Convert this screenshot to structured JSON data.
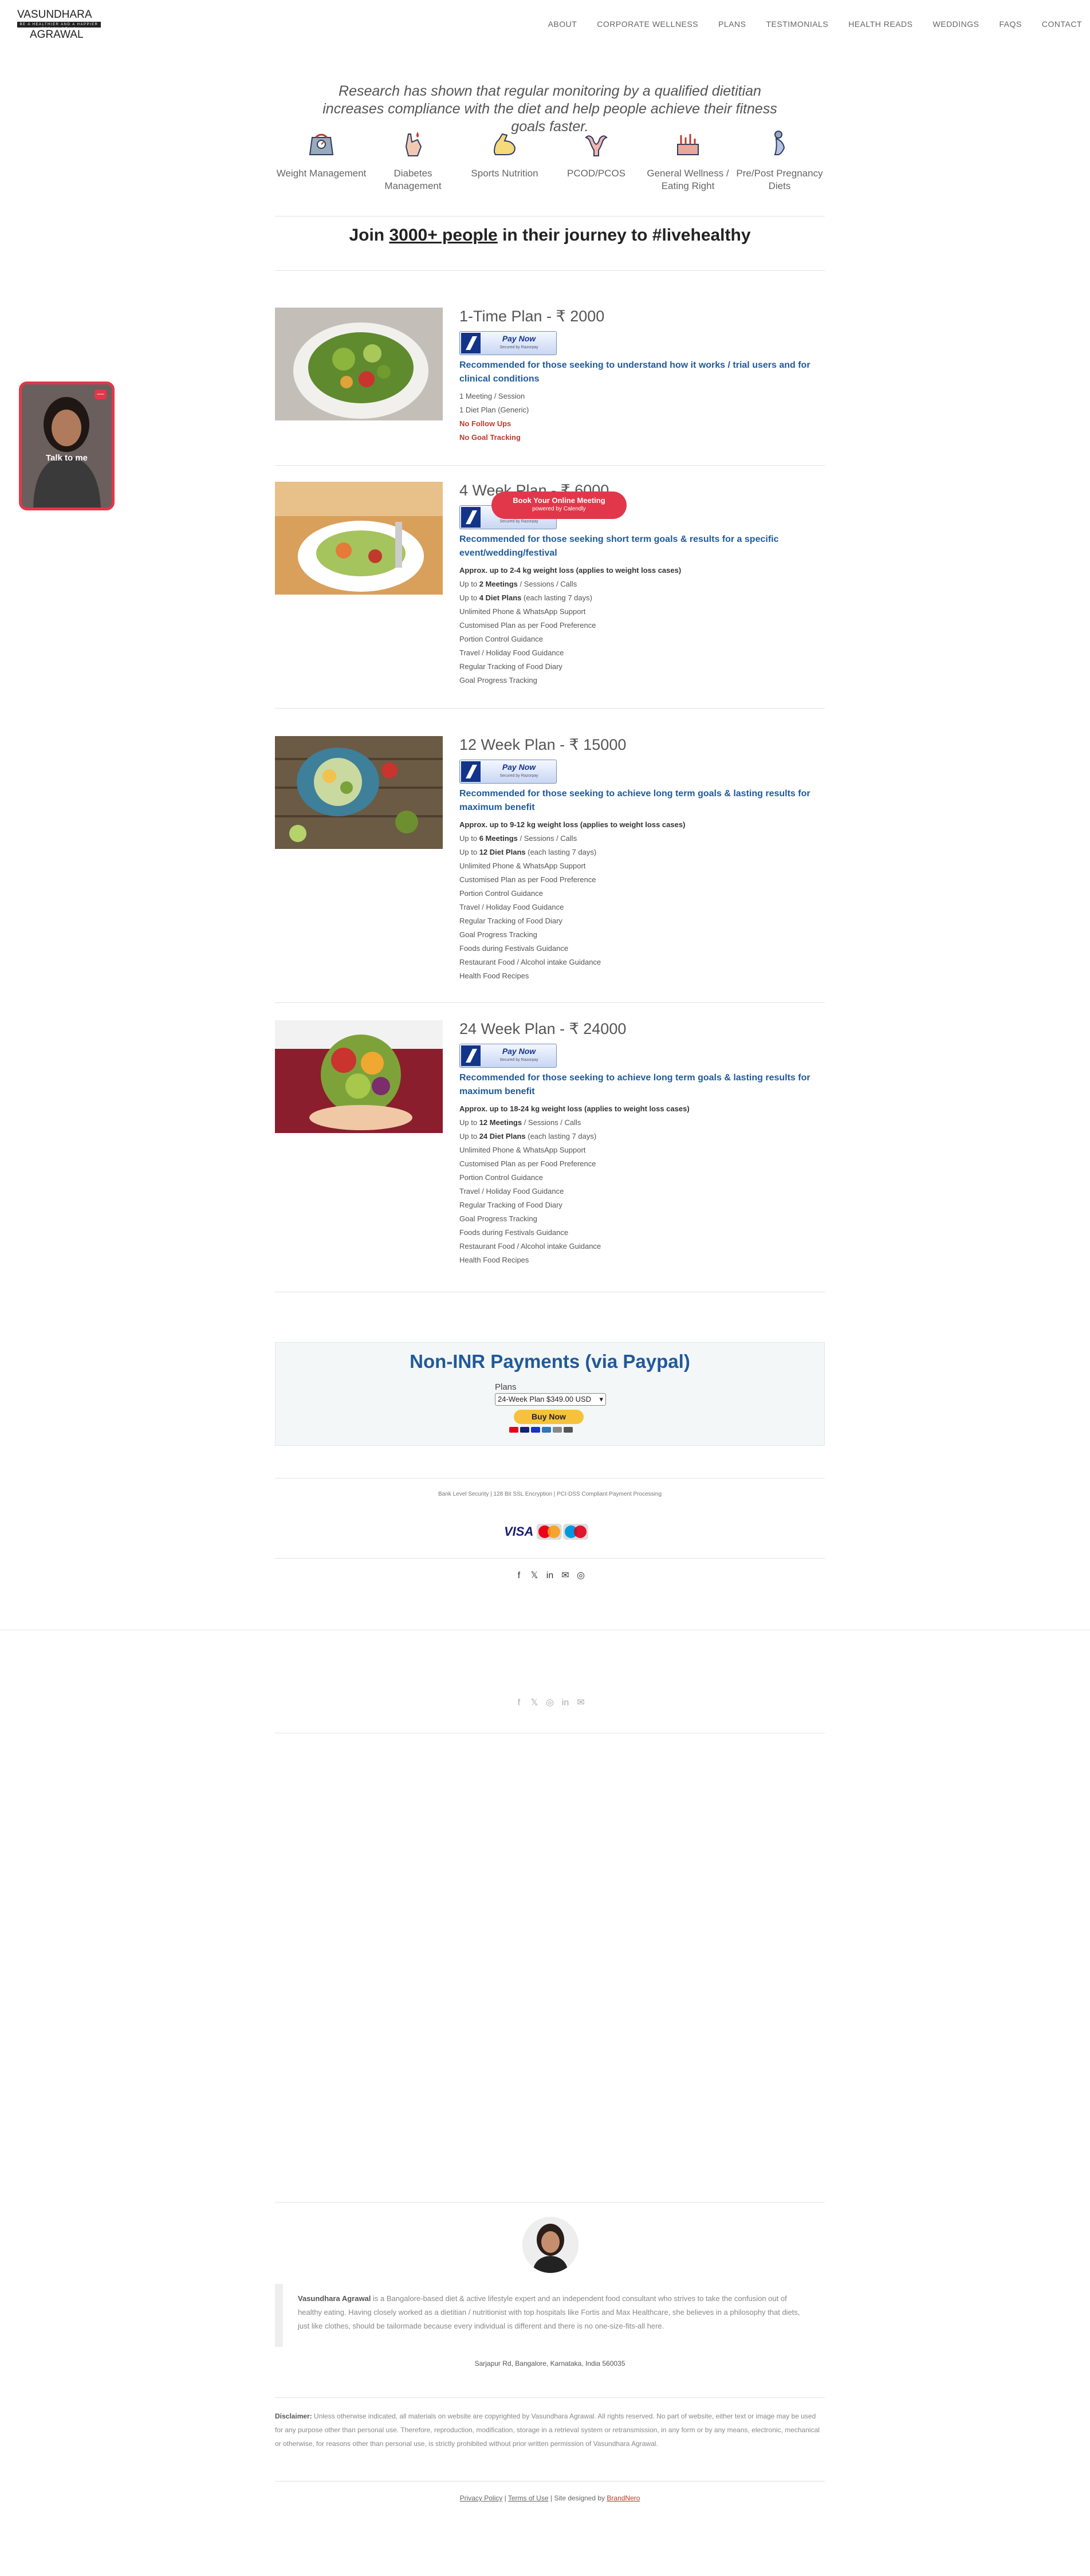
{
  "brand": {
    "line1": "VASUNDHARA",
    "line2": "BE A HEALTHIER AND A HAPPIER VERSION OF YOU",
    "line3": "AGRAWAL"
  },
  "nav": [
    "ABOUT",
    "CORPORATE WELLNESS",
    "PLANS",
    "TESTIMONIALS",
    "HEALTH READS",
    "WEDDINGS",
    "FAQS",
    "CONTACT"
  ],
  "intro": "Research has shown that regular monitoring by a qualified dietitian increases compliance with the diet and help people achieve their fitness goals faster.",
  "categories": [
    {
      "icon": "scale-icon",
      "label": "Weight Management"
    },
    {
      "icon": "diabetes-icon",
      "label": "Diabetes Management"
    },
    {
      "icon": "muscle-icon",
      "label": "Sports Nutrition"
    },
    {
      "icon": "uterus-icon",
      "label": "PCOD/PCOS"
    },
    {
      "icon": "wellness-icon",
      "label": "General Wellness / Eating Right"
    },
    {
      "icon": "pregnancy-icon",
      "label": "Pre/Post Pregnancy Diets"
    }
  ],
  "join": {
    "pre": "Join ",
    "link": "3000+ people",
    "post": " in their journey to #livehealthy"
  },
  "pay_button": {
    "label": "Pay Now",
    "secured": "Secured by Razorpay"
  },
  "plans": [
    {
      "title": "1-Time Plan - ₹ 2000",
      "rec": "Recommended for those seeking to understand how it works / trial users and for clinical conditions",
      "lines": [
        "1 Meeting / Session",
        "1 Diet Plan (Generic)"
      ],
      "red": [
        "No Follow Ups",
        "No Goal Tracking"
      ]
    },
    {
      "title": "4 Week Plan - ₹ 6000",
      "rec": "Recommended for those seeking short term goals & results for a specific event/wedding/festival",
      "bold": "Approx. up to 2-4 kg weight loss (applies to weight loss cases)",
      "l1": [
        "Up to ",
        "2 Meetings",
        " / Sessions / Calls"
      ],
      "l2": [
        "Up to ",
        "4 Diet Plans",
        " (each lasting 7 days)"
      ],
      "lines": [
        "Unlimited Phone & WhatsApp Support",
        "Customised Plan as per Food Preference",
        "Portion Control Guidance",
        "Travel / Holiday Food Guidance",
        "Regular Tracking of Food Diary",
        "Goal Progress Tracking"
      ]
    },
    {
      "title": "12 Week Plan - ₹ 15000",
      "rec": "Recommended for those seeking to achieve long term goals & lasting results for maximum benefit",
      "bold": "Approx. up to 9-12 kg weight loss (applies to weight loss cases)",
      "l1": [
        "Up to ",
        "6 Meetings",
        " / Sessions / Calls"
      ],
      "l2": [
        "Up to ",
        "12 Diet Plans",
        " (each lasting 7 days)"
      ],
      "lines": [
        "Unlimited Phone & WhatsApp Support",
        "Customised Plan as per Food Preference",
        "Portion Control Guidance",
        "Travel / Holiday Food Guidance",
        "Regular Tracking of Food Diary",
        "Goal Progress Tracking",
        "Foods during Festivals Guidance",
        "Restaurant Food / Alcohol intake Guidance",
        "Health Food Recipes"
      ]
    },
    {
      "title": "24 Week Plan -  ₹ 24000",
      "rec": "Recommended for those seeking to achieve long term goals & lasting results for maximum benefit",
      "bold": "Approx. up to 18-24 kg weight loss (applies to weight loss cases)",
      "l1": [
        "Up to ",
        "12 Meetings",
        " / Sessions / Calls"
      ],
      "l2": [
        "Up to ",
        "24 Diet Plans",
        " (each lasting 7 days)"
      ],
      "lines": [
        "Unlimited Phone & WhatsApp Support",
        "Customised Plan as per Food Preference",
        "Portion Control Guidance",
        "Travel / Holiday Food Guidance",
        "Regular Tracking of Food Diary",
        "Goal Progress Tracking",
        "Foods during Festivals Guidance",
        "Restaurant Food / Alcohol intake Guidance",
        "Health Food Recipes"
      ]
    }
  ],
  "paypal": {
    "title": "Non-INR Payments (via Paypal)",
    "plans_label": "Plans",
    "selected": "24-Week Plan $349.00 USD",
    "buy": "Buy Now"
  },
  "bank": "Bank Level Security  |  128 Bit SSL Encryption  |  PCI-DSS Compliant Payment Processing",
  "cards": {
    "visa": "VISA",
    "mastercard": "mastercard",
    "maestro": "Maestro"
  },
  "social_icons": [
    "facebook-icon",
    "twitter-icon",
    "linkedin-icon",
    "mail-icon",
    "instagram-icon"
  ],
  "social_glyphs": [
    "f",
    "𝕏",
    "in",
    "✉",
    "◎"
  ],
  "social_icons_2": [
    "facebook-icon",
    "twitter-icon",
    "instagram-icon",
    "linkedin-icon",
    "mail-icon"
  ],
  "social_glyphs_2": [
    "f",
    "𝕏",
    "◎",
    "in",
    "✉"
  ],
  "bio": {
    "name": "Vasundhara Agrawal",
    "text": " is a Bangalore-based diet & active lifestyle expert and an independent food consultant who strives to take the confusion out of healthy eating. Having closely worked as a dietitian / nutritionist with top hospitals like Fortis and Max Healthcare, she believes in a philosophy that diets, just like clothes, should be tailormade because every individual is different and there is no one-size-fits-all here."
  },
  "address": "Sarjapur Rd, Bangalore, Karnataka, India 560035",
  "disclaimer": {
    "label": "Disclaimer:",
    "text": " Unless otherwise indicated, all materials on website are copyrighted by Vasundhara Agrawal. All rights reserved. No part of website, either text or image may be used for any purpose other than personal use. Therefore, reproduction, modification, storage in a retrieval system or retransmission, in any form or by any means, electronic, mechanical or otherwise, for reasons other than personal use, is strictly prohibited without prior written permission of Vasundhara Agrawal."
  },
  "legal": {
    "privacy": "Privacy Policy",
    "terms": "Terms of Use",
    "designed": "Site designed by",
    "brand": "BrandNero",
    "sep": " | "
  },
  "talk": {
    "label": "Talk to me",
    "minimize": "—"
  },
  "calendly": {
    "label": "Book Your Online Meeting",
    "sub": "powered by Calendly"
  },
  "colors": {
    "accent_blue": "#1f5a9b",
    "red": "#e2374a",
    "paypal_yellow": "#f7c23b"
  }
}
